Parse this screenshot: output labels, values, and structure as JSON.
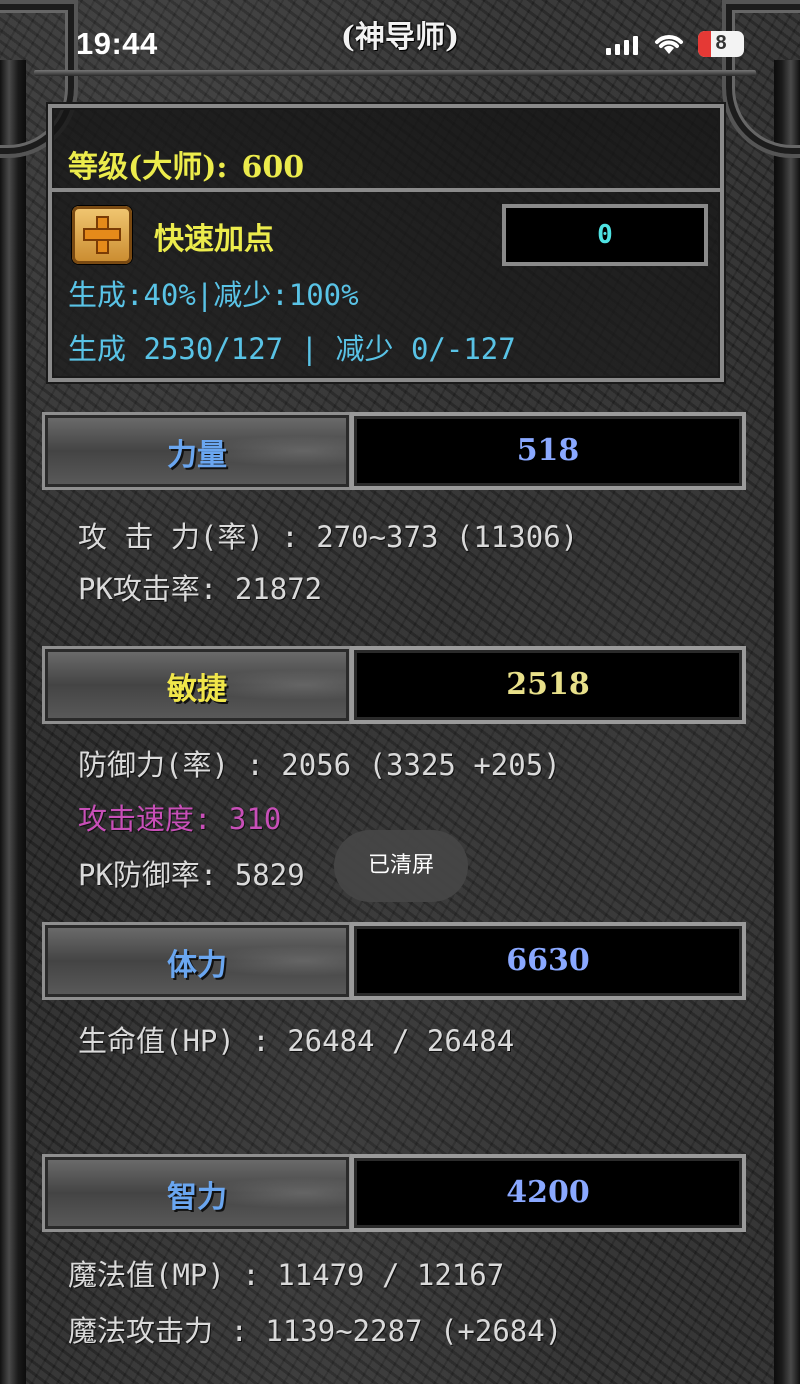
{
  "status_bar": {
    "time": "19:44",
    "battery_level": "8",
    "icons": [
      "signal-icon",
      "wifi-icon",
      "battery-icon"
    ]
  },
  "header": {
    "title": "(神导师)"
  },
  "level_panel": {
    "level_label": "等级(大师):",
    "level_value": "600",
    "quick_add_label": "快速加点",
    "free_points": "0",
    "generate_line1": "生成:40%|减少:100%",
    "generate_line2": "生成 2530/127 | 减少 0/-127"
  },
  "stats": [
    {
      "label": "力量",
      "value": "518",
      "label_color": "#6aa6f0",
      "value_color": "#8aa8ff"
    },
    {
      "label": "敏捷",
      "value": "2518",
      "label_color": "#f0e64a",
      "value_color": "#e8e08a"
    },
    {
      "label": "体力",
      "value": "6630",
      "label_color": "#6aa6f0",
      "value_color": "#8aa8ff"
    },
    {
      "label": "智力",
      "value": "4200",
      "label_color": "#6aa6f0",
      "value_color": "#8aa8ff"
    }
  ],
  "details": {
    "attack_power": "攻 击 力(率) : 270~373 (11306)",
    "pk_attack_rate": "PK攻击率: 21872",
    "defense": "防御力(率) : 2056 (3325 +205)",
    "attack_speed": "攻击速度: 310",
    "pk_defense_rate": "PK防御率: 5829",
    "hp": "生命值(HP) : 26484 / 26484",
    "mp": "魔法值(MP) : 11479 / 12167",
    "magic_attack": "魔法攻击力 : 1139~2287 (+2684)"
  },
  "toast": "已清屏",
  "colors": {
    "attack_speed": "#c84fb8"
  }
}
